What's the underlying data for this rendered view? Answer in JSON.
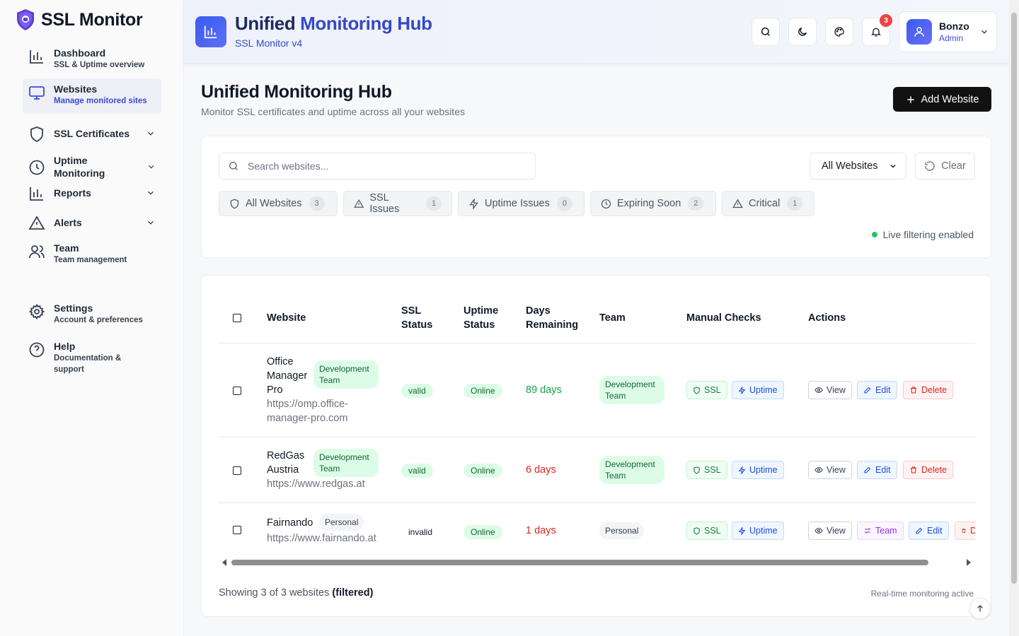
{
  "sidebar": {
    "brand": "SSL Monitor",
    "items": [
      {
        "label": "Dashboard",
        "sub": "SSL & Uptime overview"
      },
      {
        "label": "Websites",
        "sub": "Manage monitored sites"
      },
      {
        "label": "SSL Certificates"
      },
      {
        "label": "Uptime Monitoring"
      },
      {
        "label": "Reports"
      },
      {
        "label": "Alerts"
      },
      {
        "label": "Team",
        "sub": "Team management"
      },
      {
        "label": "Settings",
        "sub": "Account & preferences"
      },
      {
        "label": "Help",
        "sub": "Documentation & support"
      }
    ]
  },
  "header": {
    "title_a": "Unified",
    "title_b": "Monitoring Hub",
    "subtitle": "SSL Monitor v4",
    "notifications": "3",
    "user_name": "Bonzo",
    "user_role": "Admin"
  },
  "page": {
    "title": "Unified Monitoring Hub",
    "subtitle": "Monitor SSL certificates and uptime across all your websites",
    "add_label": "Add Website"
  },
  "filters": {
    "search_placeholder": "Search websites...",
    "select_value": "All Websites",
    "clear_label": "Clear",
    "chips": [
      {
        "label": "All Websites",
        "count": "3"
      },
      {
        "label": "SSL Issues",
        "count": "1"
      },
      {
        "label": "Uptime Issues",
        "count": "0"
      },
      {
        "label": "Expiring Soon",
        "count": "2"
      },
      {
        "label": "Critical",
        "count": "1"
      }
    ],
    "live": "Live filtering enabled"
  },
  "table": {
    "headers": {
      "website": "Website",
      "ssl_1": "SSL",
      "ssl_2": "Status",
      "up_1": "Uptime",
      "up_2": "Status",
      "days_1": "Days",
      "days_2": "Remaining",
      "team": "Team",
      "checks": "Manual Checks",
      "actions": "Actions"
    },
    "rows": [
      {
        "name_1": "Office",
        "name_2": "Manager",
        "name_3": "Pro",
        "tag_1": "Development",
        "tag_2": "Team",
        "url_1": "https://omp.office-",
        "url_2": "manager-pro.com",
        "ssl": "valid",
        "uptime": "Online",
        "days": "89 days",
        "team_1": "Development",
        "team_2": "Team"
      },
      {
        "name_1": "RedGas",
        "name_2": "Austria",
        "tag_1": "Development",
        "tag_2": "Team",
        "url_1": "https://www.redgas.at",
        "ssl": "valid",
        "uptime": "Online",
        "days": "6 days",
        "team_1": "Development",
        "team_2": "Team"
      },
      {
        "name_1": "Fairnando",
        "tag_1": "Personal",
        "url_1": "https://www.fairnando.at",
        "ssl": "invalid",
        "uptime": "Online",
        "days": "1 days",
        "team_1": "Personal"
      }
    ],
    "btn": {
      "ssl": "SSL",
      "uptime": "Uptime",
      "view": "View",
      "edit": "Edit",
      "delete": "Delete",
      "team": "Team",
      "delete_cut": "D"
    }
  },
  "footer": {
    "showing": "Showing 3 of 3 websites",
    "filtered": "(filtered)",
    "realtime": "Real-time monitoring active"
  },
  "colors": {
    "accent": "#3b4bd8",
    "dark_button": "#111111",
    "success": "#16a34a",
    "danger": "#dc2626"
  }
}
